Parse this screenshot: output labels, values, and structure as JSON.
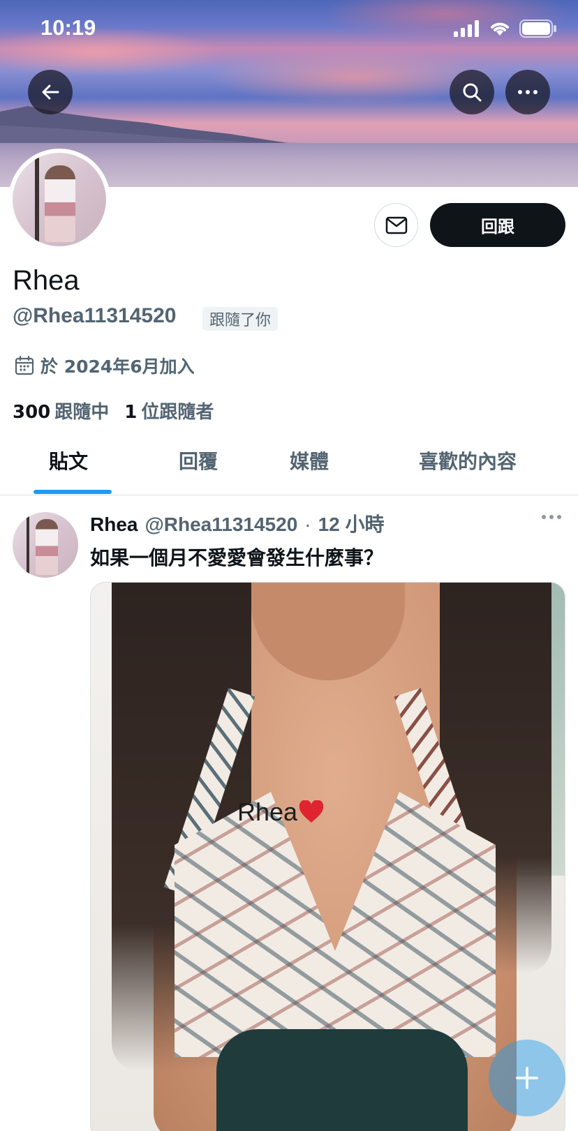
{
  "status_bar": {
    "time": "10:19"
  },
  "banner": {
    "icons": [
      "back-arrow-icon",
      "search-icon",
      "more-icon"
    ]
  },
  "profile": {
    "display_name": "Rhea",
    "handle": "@Rhea11314520",
    "follows_you_label": "跟隨了你",
    "joined": "於 2024年6月加入",
    "following_count": "300",
    "following_label": "跟隨中",
    "followers_count": "1",
    "followers_label": "位跟隨者",
    "follow_back_label": "回跟"
  },
  "tabs": [
    {
      "label": "貼文",
      "active": true
    },
    {
      "label": "回覆",
      "active": false
    },
    {
      "label": "媒體",
      "active": false
    },
    {
      "label": "喜歡的內容",
      "active": false
    }
  ],
  "post": {
    "name": "Rhea",
    "handle": "@Rhea11314520",
    "separator": "·",
    "time": "12 小時",
    "text": "如果一個月不愛愛會發生什麼事？",
    "media_watermark": "Rhea"
  },
  "colors": {
    "accent": "#1d9bf0",
    "text_primary": "#0f1419",
    "text_secondary": "#536471"
  }
}
